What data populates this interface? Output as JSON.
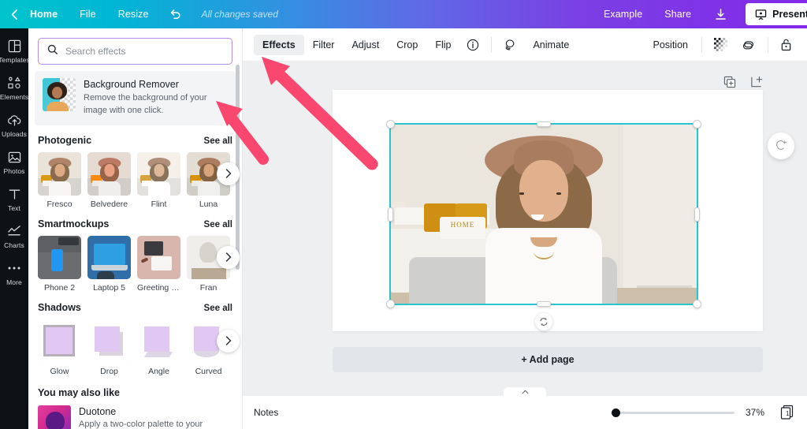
{
  "topbar": {
    "back_chevron": "chevron-left",
    "home": "Home",
    "file": "File",
    "resize": "Resize",
    "undo": "undo-icon",
    "status": "All changes saved",
    "example": "Example",
    "share": "Share",
    "download": "download-icon",
    "present": "Present"
  },
  "rail": {
    "items": [
      {
        "label": "Templates",
        "icon": "templates-icon"
      },
      {
        "label": "Elements",
        "icon": "elements-icon"
      },
      {
        "label": "Uploads",
        "icon": "uploads-icon"
      },
      {
        "label": "Photos",
        "icon": "photos-icon"
      },
      {
        "label": "Text",
        "icon": "text-icon"
      },
      {
        "label": "Charts",
        "icon": "charts-icon"
      },
      {
        "label": "More",
        "icon": "more-icon"
      }
    ]
  },
  "panel": {
    "search": {
      "placeholder": "Search effects",
      "value": "",
      "icon": "search-icon"
    },
    "background_remover": {
      "title": "Background Remover",
      "description": "Remove the background of your image with one click."
    },
    "sections": [
      {
        "title": "Photogenic",
        "see_all": "See all",
        "tiles": [
          {
            "label": "Fresco"
          },
          {
            "label": "Belvedere"
          },
          {
            "label": "Flint"
          },
          {
            "label": "Luna"
          }
        ]
      },
      {
        "title": "Smartmockups",
        "see_all": "See all",
        "tiles": [
          {
            "label": "Phone 2"
          },
          {
            "label": "Laptop 5"
          },
          {
            "label": "Greeting car..."
          },
          {
            "label": "Fran"
          }
        ]
      },
      {
        "title": "Shadows",
        "see_all": "See all",
        "tiles": [
          {
            "label": "Glow"
          },
          {
            "label": "Drop"
          },
          {
            "label": "Angle"
          },
          {
            "label": "Curved"
          }
        ]
      }
    ],
    "you_may_also_like": {
      "title": "You may also like",
      "item": {
        "title": "Duotone",
        "description": "Apply a two-color palette to your"
      }
    }
  },
  "toolbar": {
    "tabs": [
      {
        "label": "Effects",
        "active": true
      },
      {
        "label": "Filter",
        "active": false
      },
      {
        "label": "Adjust",
        "active": false
      },
      {
        "label": "Crop",
        "active": false
      },
      {
        "label": "Flip",
        "active": false
      }
    ],
    "info_icon": "info-icon",
    "animate": {
      "label": "Animate",
      "icon": "animate-icon"
    },
    "position": "Position",
    "transparency_icon": "transparency-icon",
    "duplicate_link_icon": "link-icon",
    "lock_icon": "lock-icon"
  },
  "canvas": {
    "duplicate_page_icon": "duplicate-page-icon",
    "add_page_icon": "add-page-icon",
    "add_page_label": "+ Add page",
    "rotate_handle_icon": "rotate-icon",
    "float_rotate_icon": "rotate-plus-icon"
  },
  "bottombar": {
    "collapse_icon": "chevron-up-icon",
    "notes": "Notes",
    "zoom_percent": "37%",
    "page_number": "1"
  },
  "colors": {
    "brand_teal": "#00c4cc",
    "brand_purple": "#7d2ae8",
    "selection": "#29c4cd",
    "annotation": "#f9476f",
    "rail_bg": "#0d1216"
  }
}
